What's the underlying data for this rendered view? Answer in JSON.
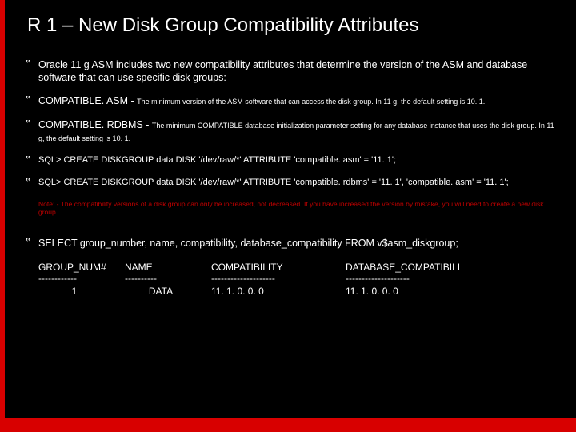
{
  "title": "R 1 – New Disk Group Compatibility Attributes",
  "bullets": {
    "intro": "Oracle 11 g ASM includes two new compatibility attributes that determine the version of the ASM and database software that can use specific disk groups:",
    "asm_label": "COMPATIBLE. ASM - ",
    "asm_desc": "The minimum version of the ASM software that can access the disk group. In 11 g, the default setting is 10. 1.",
    "rdbms_label": "COMPATIBLE. RDBMS - ",
    "rdbms_desc": "The minimum COMPATIBLE database initialization parameter setting for any database instance that uses the disk group. In 11 g, the default setting is 10. 1.",
    "sql1": "SQL> CREATE DISKGROUP data DISK '/dev/raw/*'  ATTRIBUTE 'compatible. asm' = '11. 1';",
    "sql2": "SQL> CREATE DISKGROUP data DISK '/dev/raw/*'  ATTRIBUTE 'compatible. rdbms' = '11. 1', 'compatible. asm' = '11. 1';",
    "select": "SELECT group_number, name, compatibility, database_compatibility FROM v$asm_diskgroup;"
  },
  "note": "Note: - The compatibility versions of a disk group can only be increased, not decreased. If you have increased the version by mistake, you will need to create a new disk group.",
  "table": {
    "h1": "GROUP_NUM#",
    "d1": "------------",
    "v1": "1",
    "h2": "NAME",
    "d2": "----------",
    "v2": "DATA",
    "h3": "COMPATIBILITY",
    "d3": "--------------------",
    "v3": "11. 1. 0. 0. 0",
    "h4": "DATABASE_COMPATIBILI",
    "d4": "--------------------",
    "v4": "11. 1. 0. 0. 0"
  }
}
